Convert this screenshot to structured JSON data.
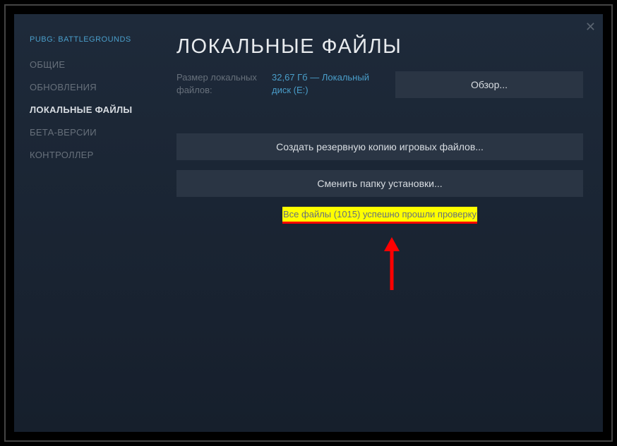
{
  "game_title": "PUBG: BATTLEGROUNDS",
  "sidebar": {
    "items": [
      {
        "label": "ОБЩИЕ",
        "active": false
      },
      {
        "label": "ОБНОВЛЕНИЯ",
        "active": false
      },
      {
        "label": "ЛОКАЛЬНЫЕ ФАЙЛЫ",
        "active": true
      },
      {
        "label": "БЕТА-ВЕРСИИ",
        "active": false
      },
      {
        "label": "КОНТРОЛЛЕР",
        "active": false
      }
    ]
  },
  "content": {
    "title": "ЛОКАЛЬНЫЕ ФАЙЛЫ",
    "size_label": "Размер локальных файлов:",
    "size_value": "32,67 Гб — Локальный диск (E:)",
    "browse_label": "Обзор...",
    "backup_label": "Создать резервную копию игровых файлов...",
    "move_label": "Сменить папку установки...",
    "validation_status": "Все файлы (1015) успешно прошли проверку"
  }
}
